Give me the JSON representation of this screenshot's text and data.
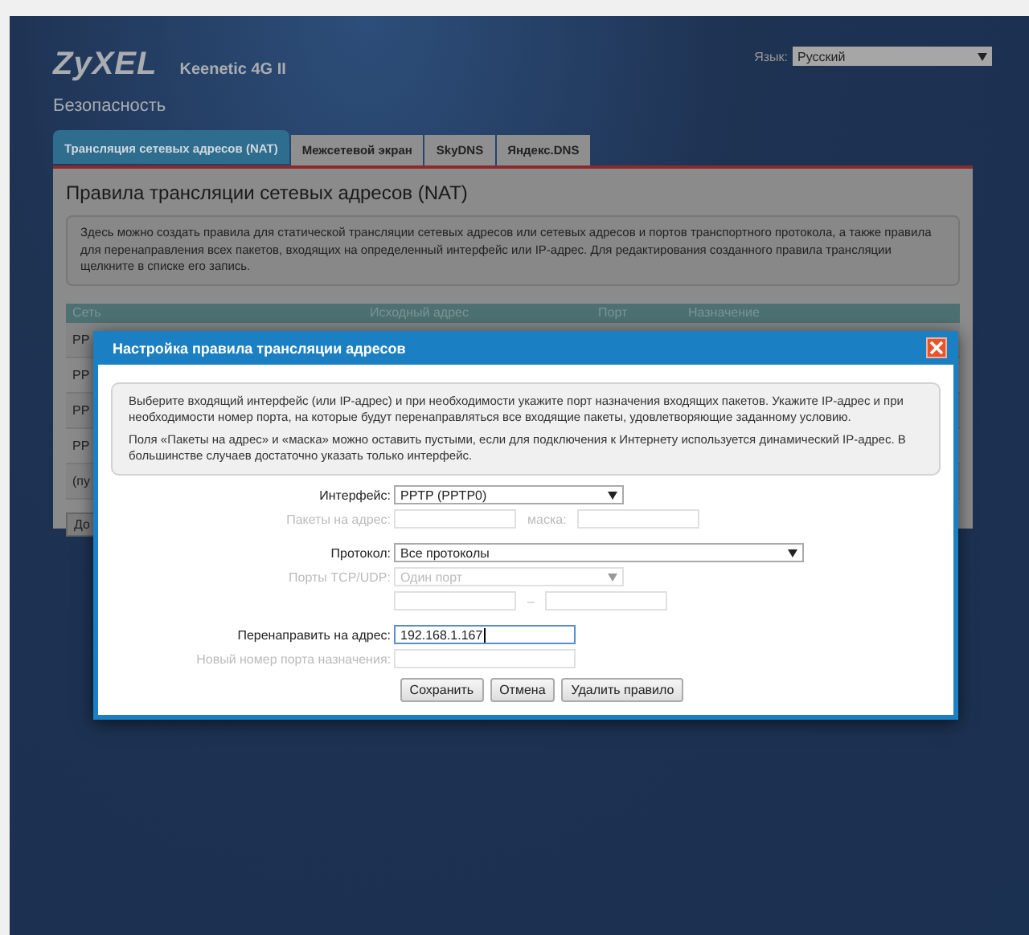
{
  "header": {
    "logo": "ZyXEL",
    "model": "Keenetic 4G II",
    "language_label": "Язык:",
    "language_value": "Русский",
    "section_title": "Безопасность"
  },
  "tabs": [
    {
      "label": "Трансляция сетевых адресов (NAT)",
      "selected": true
    },
    {
      "label": "Межсетевой экран",
      "selected": false
    },
    {
      "label": "SkyDNS",
      "selected": false
    },
    {
      "label": "Яндекс.DNS",
      "selected": false
    }
  ],
  "panel": {
    "title": "Правила трансляции сетевых адресов (NAT)",
    "description": "Здесь можно создать правила для статической трансляции сетевых адресов или сетевых адресов и портов транспортного протокола, а также правила для перенаправления всех пакетов, входящих на определенный интерфейс или IP-адрес. Для редактирования созданного правила трансляции щелкните в списке его запись.",
    "table": {
      "columns": [
        "Сеть",
        "Исходный адрес",
        "Порт",
        "Назначение"
      ],
      "rows": [
        {
          "column_1": "PP"
        },
        {
          "column_1": "PP"
        },
        {
          "column_1": "PP"
        },
        {
          "column_1": "PP"
        },
        {
          "column_1": "(пу"
        }
      ]
    },
    "add_button": "До"
  },
  "dialog": {
    "title": "Настройка правила трансляции адресов",
    "info": [
      "Выберите входящий интерфейс (или IP-адрес) и при необходимости укажите порт назначения входящих пакетов. Укажите IP-адрес и при необходимости номер порта, на которые будут перенаправляться все входящие пакеты, удовлетворяющие заданному условию.",
      "Поля «Пакеты на адрес» и «маска» можно оставить пустыми, если для подключения к Интернету используется динамический IP-адрес. В большинстве случаев достаточно указать только интерфейс."
    ],
    "field_groups": [
      [
        {
          "kind": "select",
          "label": "Интерфейс:",
          "value": "PPTP (PPTP0)",
          "disabled": false
        },
        {
          "kind": "ip_mask",
          "label": "Пакеты на адрес:",
          "mask_label": "маска:",
          "disabled": true
        }
      ],
      [
        {
          "kind": "select_wide",
          "label": "Протокол:",
          "value": "Все протоколы",
          "disabled": false
        },
        {
          "kind": "select",
          "label": "Порты TCP/UDP:",
          "value": "Один порт",
          "disabled": true
        },
        {
          "kind": "range",
          "separator": "–",
          "disabled": true
        }
      ],
      [
        {
          "kind": "text",
          "label": "Перенаправить на адрес:",
          "value": "192.168.1.167",
          "disabled": false,
          "focused": true
        },
        {
          "kind": "text",
          "label": "Новый номер порта назначения:",
          "disabled": true,
          "focused": false
        }
      ]
    ],
    "buttons": [
      "Сохранить",
      "Отмена",
      "Удалить правило"
    ]
  }
}
